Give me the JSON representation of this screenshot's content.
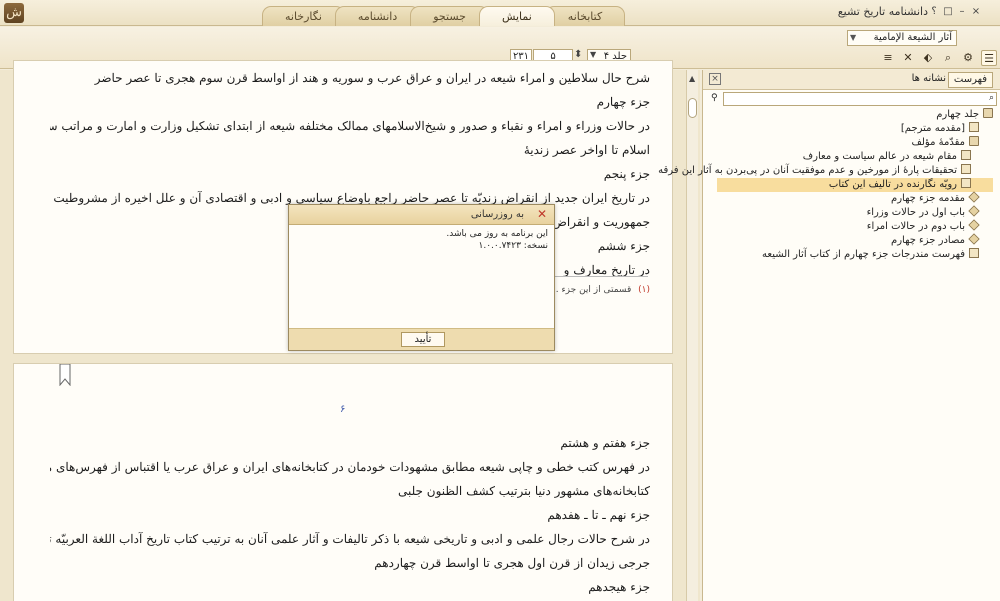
{
  "window": {
    "title": "دانشنامه تاریخ تشیع",
    "controls": [
      "؟",
      "□",
      "–",
      "×"
    ]
  },
  "tabs": [
    {
      "label": "نگارخانه"
    },
    {
      "label": "دانشنامه"
    },
    {
      "label": "جستجو"
    },
    {
      "label": "نمایش"
    },
    {
      "label": "کتابخانه"
    }
  ],
  "toolbar": {
    "book_title": "آثار الشیعة الإمامیة",
    "volume": "جلد ۴",
    "page": "۵",
    "total_pages": "۲۳۱"
  },
  "page1": {
    "lines": [
      "شرح حال سلاطین و امراء شیعه در ایران و عراق عرب و سوریه و هند از اواسط قرن سوم هجری تا عصر حاضر",
      "جزء چهارم",
      "در حالات وزراء و امراء و نقباء و صدور و شیخ‌الاسلامهای ممالک مختلفه شیعه از ابتدای تشکیل وزارت و امارت و مراتب سیاسی در",
      "اسلام تا اواخر عصر زندیهٔ",
      "جزء پنجم",
      "در تاریخ ایران جدید از انقراض زندیّه تا عصر حاضر راجع باوضاع سیاسی و ادبی و اقتصادی آن و علل اخیره از مشروطیت و",
      "جمهوریت و انقراض",
      "جزء ششم",
      "در تاریخ معارف و"
    ],
    "footnote_number": "(۱)",
    "footnote_text": "قسمتی از این جزء ... محظورات تاکنون تمام نشده است ـ"
  },
  "page2": {
    "page_number": "۶",
    "lines": [
      "جزء هفتم و هشتم",
      "در فهرس کتب خطی و چاپی شیعه مطابق مشهودات خودمان در کتابخانه‌های ایران و عراق عرب یا اقتباس از فهرس‌های مفصل",
      "کتابخانه‌های مشهور دنیا بترتیب کشف الظنون جلبی",
      "جزء نهم ـ تا ـ هفدهم",
      "در شرح حالات رجال علمی و ادبی و تاریخی شیعه با ذکر تالیفات و آثار علمی آنان به ترتیب کتاب تاریخ آداب اللغة العربیّه تالیف",
      "جرجی زیدان از قرن اول هجری تا اواسط قرن چهاردهم",
      "جزء هیجدهم"
    ]
  },
  "sidebar": {
    "tab_toc": "فهرست",
    "tab_bookmarks": "نشانه ها",
    "search_placeholder": "",
    "toc": [
      {
        "label": "جلد چهارم",
        "level": 0,
        "icon": "book"
      },
      {
        "label": "[مقدمه مترجم]",
        "level": 1,
        "icon": "page"
      },
      {
        "label": "مقدّمهٔ مؤلف",
        "level": 1,
        "icon": "book"
      },
      {
        "label": "مقام شیعه در عالم سیاست و معارف",
        "level": 2,
        "icon": "page"
      },
      {
        "label": "تحقیقات پارهٔ از مورخین و عدم موفقیت آنان در پی‌بردن به آثار این فرقه",
        "level": 2,
        "icon": "page"
      },
      {
        "label": "رویّه نگارنده در تالیف این کتاب",
        "level": 2,
        "icon": "page",
        "selected": true
      },
      {
        "label": "مقدمه جزء چهارم",
        "level": 1,
        "icon": "diamond"
      },
      {
        "label": "باب اول در حالات وزراء",
        "level": 1,
        "icon": "diamond"
      },
      {
        "label": "باب دوم در حالات امراء",
        "level": 1,
        "icon": "diamond"
      },
      {
        "label": "مصادر جزء چهارم",
        "level": 1,
        "icon": "diamond"
      },
      {
        "label": "فهرست مندرجات جزء چهارم از کتاب آثار الشیعه",
        "level": 1,
        "icon": "page"
      }
    ]
  },
  "dialog": {
    "title": "به روزرسانی",
    "message": "این برنامه به روز می باشد.",
    "version": "نسخه: ۱.۰.۰.۷۴۲۳",
    "ok_label": "تأیید"
  },
  "colors": {
    "accent": "#e8d29e",
    "selected": "#f8dd9e",
    "page_bg": "#fffdf8"
  }
}
